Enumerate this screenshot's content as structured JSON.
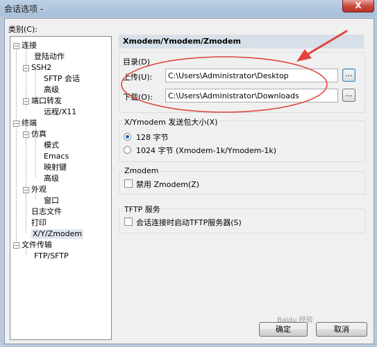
{
  "window": {
    "title": "会话选项 -",
    "close": "X"
  },
  "category_label": "类别(C):",
  "tree": [
    {
      "label": "连接"
    },
    {
      "label": "登陆动作"
    },
    {
      "label": "SSH2"
    },
    {
      "label": "SFTP 会话"
    },
    {
      "label": "高级"
    },
    {
      "label": "端口转发"
    },
    {
      "label": "远程/X11"
    },
    {
      "label": "终端"
    },
    {
      "label": "仿真"
    },
    {
      "label": "模式"
    },
    {
      "label": "Emacs"
    },
    {
      "label": "映射键"
    },
    {
      "label": "高级"
    },
    {
      "label": "外观"
    },
    {
      "label": "窗口"
    },
    {
      "label": "日志文件"
    },
    {
      "label": "打印"
    },
    {
      "label": "X/Y/Zmodem"
    },
    {
      "label": "文件传输"
    },
    {
      "label": "FTP/SFTP"
    }
  ],
  "panel_title": "Xmodem/Ymodem/Zmodem",
  "directory": {
    "label": "目录(D)",
    "upload_label": "上传(U):",
    "upload_value": "C:\\Users\\Administrator\\Desktop",
    "download_label": "下载(O):",
    "download_value": "C:\\Users\\Administrator\\Downloads",
    "browse": "..."
  },
  "packet": {
    "label": "X/Ymodem 发送包大小(X)",
    "opt1": "128 字节",
    "opt2": "1024 字节  (Xmodem-1k/Ymodem-1k)"
  },
  "zmodem": {
    "label": "Zmodem",
    "checkbox": "禁用 Zmodem(Z)"
  },
  "tftp": {
    "label": "TFTP 服务",
    "checkbox": "会话连接时启动TFTP服务器(S)"
  },
  "buttons": {
    "ok": "确定",
    "cancel": "取消"
  },
  "watermark": "Baidu 经验"
}
